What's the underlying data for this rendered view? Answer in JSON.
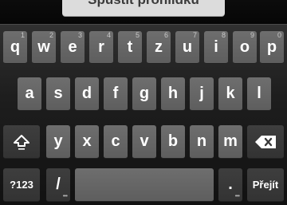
{
  "search_button": {
    "label": "Spustit prohlídku"
  },
  "keyboard": {
    "row1": [
      {
        "label": "q",
        "hint": "1"
      },
      {
        "label": "w",
        "hint": "2"
      },
      {
        "label": "e",
        "hint": "3"
      },
      {
        "label": "r",
        "hint": "4"
      },
      {
        "label": "t",
        "hint": "5"
      },
      {
        "label": "z",
        "hint": "6"
      },
      {
        "label": "u",
        "hint": "7"
      },
      {
        "label": "i",
        "hint": "8"
      },
      {
        "label": "o",
        "hint": "9"
      },
      {
        "label": "p",
        "hint": "0"
      }
    ],
    "row2": [
      "a",
      "s",
      "d",
      "f",
      "g",
      "h",
      "j",
      "k",
      "l"
    ],
    "row3": [
      "y",
      "x",
      "c",
      "v",
      "b",
      "n",
      "m"
    ],
    "symbols_label": "?123",
    "slash_label": "/",
    "period_label": ".",
    "enter_label": "Přejít",
    "shift_icon": "shift-arrow-icon",
    "backspace_icon": "backspace-icon"
  }
}
